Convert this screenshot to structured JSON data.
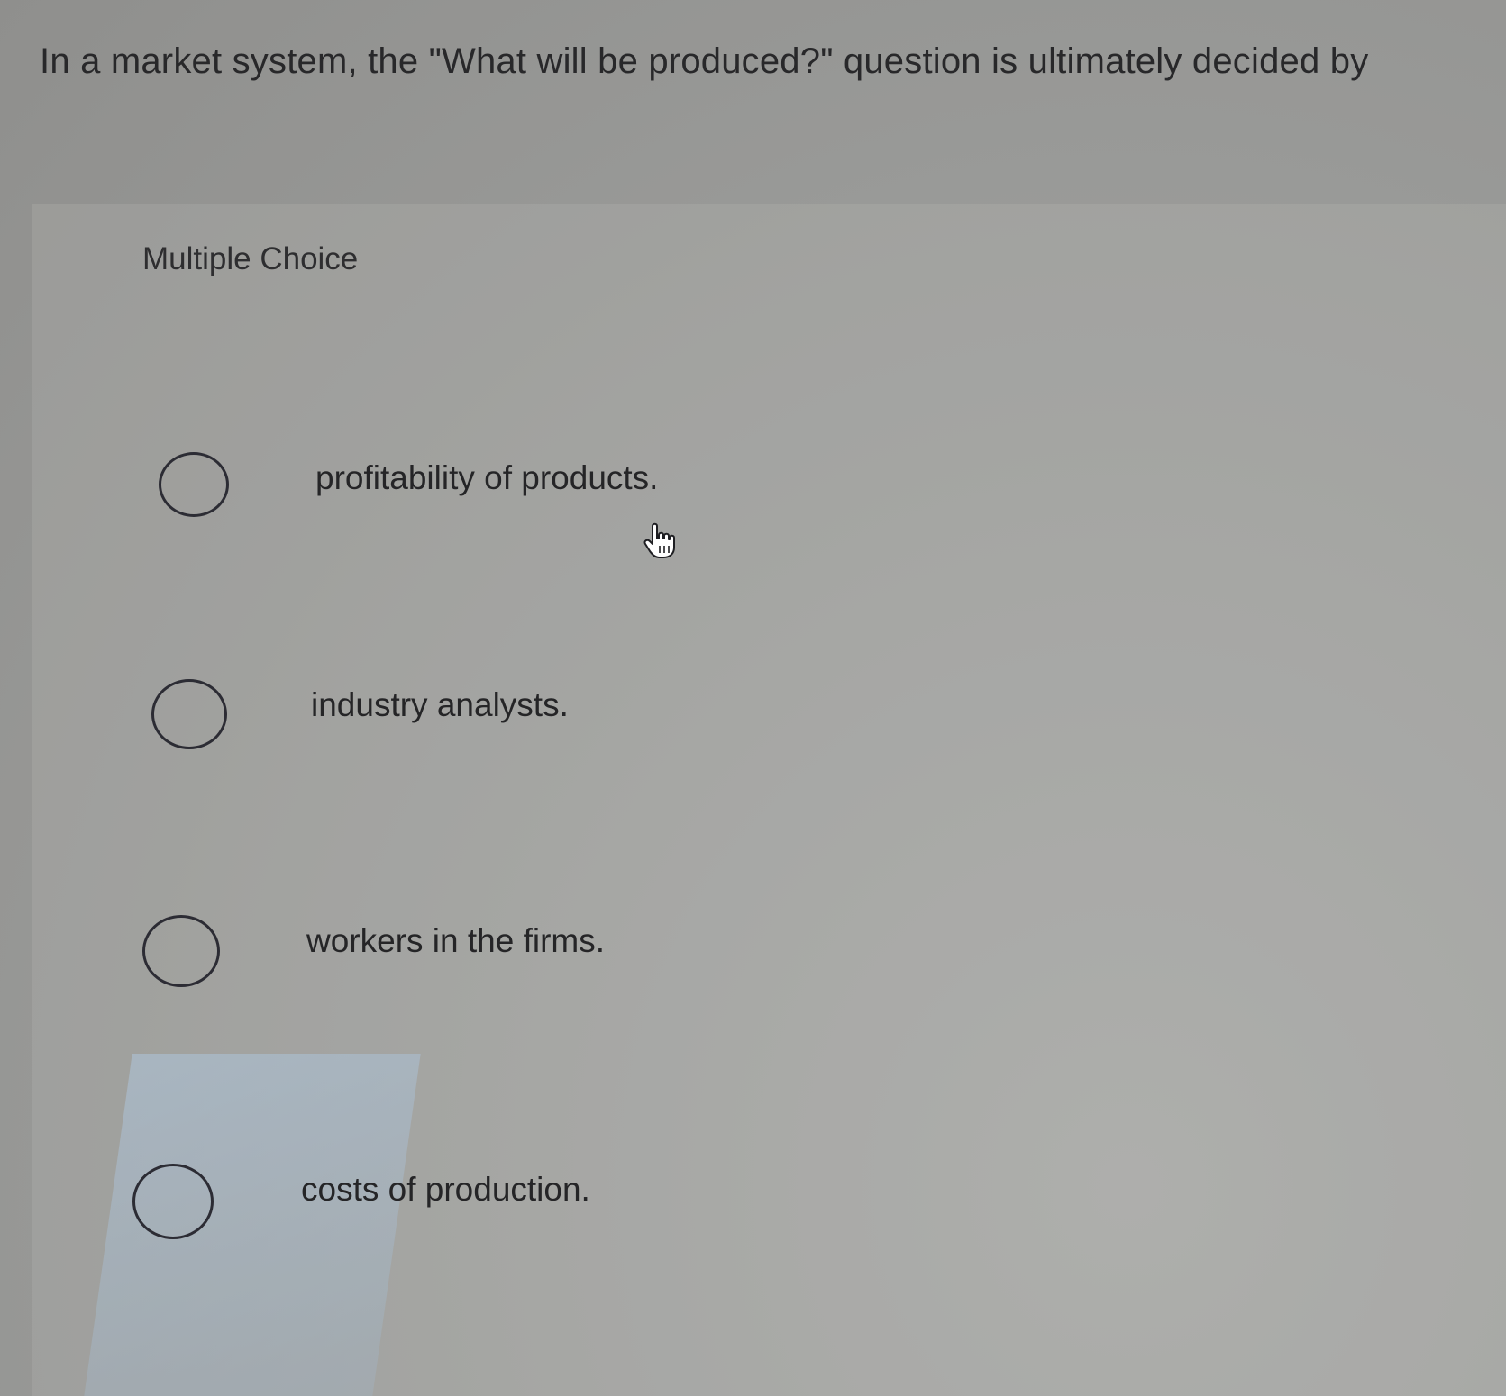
{
  "question": {
    "text": "In a market system, the \"What will be produced?\" question is ultimately decided by"
  },
  "section_label": "Multiple Choice",
  "options": [
    {
      "label": "profitability of products."
    },
    {
      "label": "industry analysts."
    },
    {
      "label": "workers in the firms."
    },
    {
      "label": "costs of production."
    }
  ],
  "cursor_icon": "hand-pointer-icon"
}
